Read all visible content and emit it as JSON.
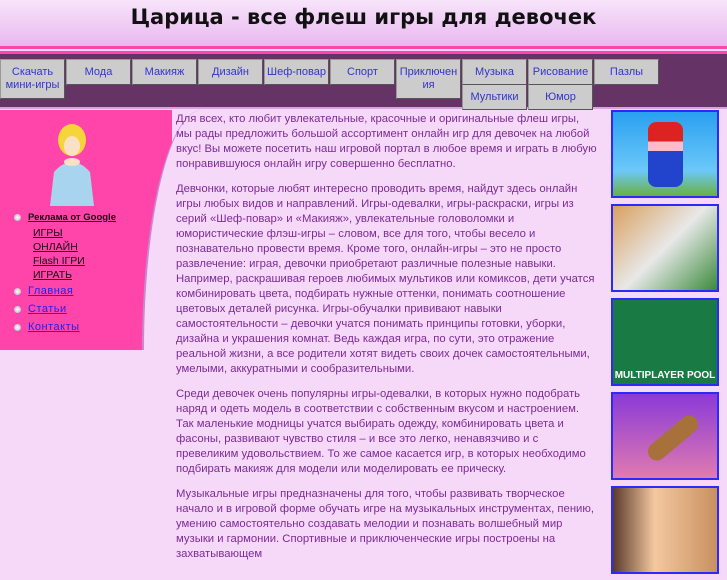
{
  "header": {
    "title": "Царица - все флеш игры для девочек"
  },
  "nav": [
    {
      "label": "Скачать мини-игры"
    },
    {
      "label": "Мода"
    },
    {
      "label": "Макияж"
    },
    {
      "label": "Дизайн"
    },
    {
      "label": "Шеф-повар"
    },
    {
      "label": "Спорт"
    },
    {
      "label": "Приключения"
    },
    {
      "label": "Музыка"
    },
    {
      "label": "Рисование"
    },
    {
      "label": "Пазлы"
    },
    {
      "label": "Мультики"
    },
    {
      "label": "Юмор"
    }
  ],
  "sidebar": {
    "ads_title": "Реклама от Google",
    "ads": [
      "ИГРЫ",
      "ОНЛАЙН",
      "Flash ІГРИ",
      "ИГРАТЬ"
    ],
    "links": [
      "Главная",
      "Статьи",
      "Контакты"
    ]
  },
  "main": {
    "paragraphs": [
      "Для всех, кто любит увлекательные, красочные и оригинальные флеш игры, мы рады предложить большой ассортимент онлайн игр для девочек на любой вкус! Вы можете посетить наш игровой портал в любое время и играть в любую понравившуюся онлайн игру совершенно бесплатно.",
      "Девчонки, которые любят интересно проводить время, найдут здесь онлайн игры любых видов и направлений. Игры-одевалки, игры-раскраски, игры из серий «Шеф-повар» и «Макияж», увлекательные головоломки и юмористические флэш-игры – словом, все для того, чтобы весело и познавательно провести время. Кроме того, онлайн-игры – это не просто развлечение: играя, девочки приобретают различные полезные навыки. Например, раскрашивая героев любимых мультиков или комиксов, дети учатся комбинировать цвета, подбирать нужные оттенки, понимать соотношение цветовых деталей рисунка. Игры-обучалки прививают навыки самостоятельности – девочки учатся понимать принципы готовки, уборки, дизайна и украшения комнат. Ведь каждая игра, по сути, это отражение реальной жизни, а все родители хотят видеть своих дочек самостоятельными, умелыми, аккуратными и сообразительными.",
      "Среди девочек очень популярны игры-одевалки, в которых нужно подобрать наряд и одеть модель в соответствии с собственным вкусом и настроением. Так маленькие модницы учатся выбирать одежду, комбинировать цвета и фасоны, развивают чувство стиля – и все это легко, ненавязчиво и с превеликим удовольствием. То же самое касается игр, в которых необходимо подбирать макияж для модели или моделировать ее прическу.",
      "Музыкальные игры предназначены для того, чтобы развивать творческое начало и в игровой форме обучать игре на музыкальных инструментах, пению, умению самостоятельно создавать мелодии и познавать волшебный мир музыки и гармонии. Спортивные и приключенческие игры построены на захватывающем"
    ]
  },
  "games": {
    "pool_title": "MULTIPLAYER POOL"
  }
}
